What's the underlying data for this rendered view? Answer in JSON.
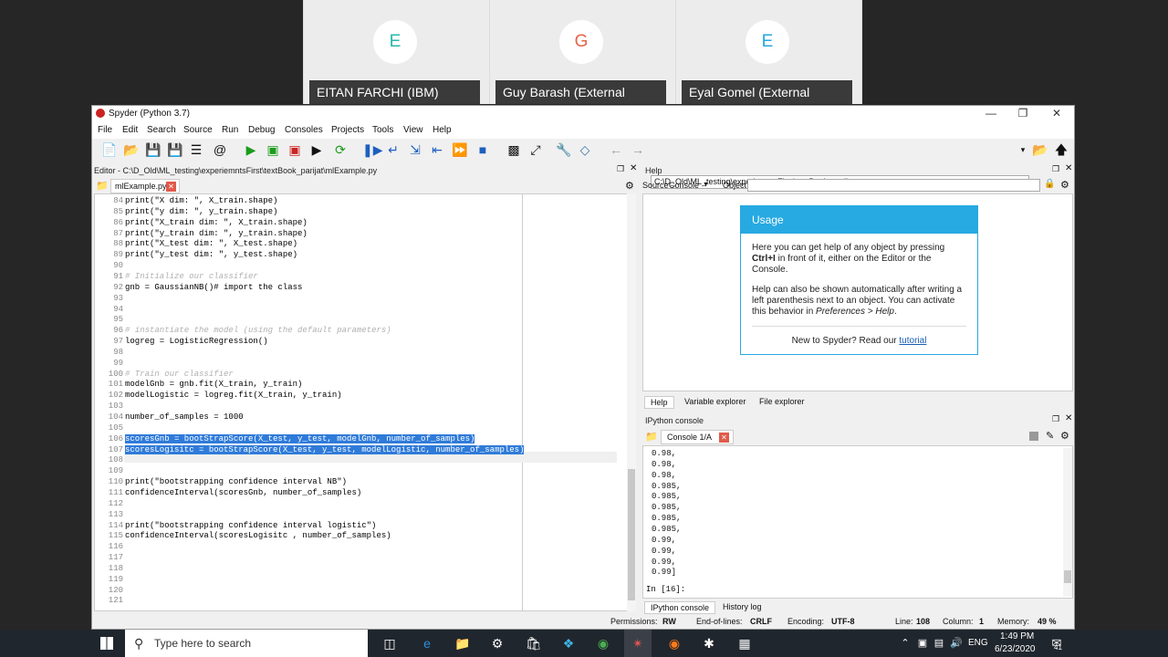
{
  "participants": [
    {
      "initial": "E",
      "name": "EITAN FARCHI (IBM)",
      "color": "#26b8a8"
    },
    {
      "initial": "G",
      "name": "Guy Barash (External",
      "color": "#e8624a"
    },
    {
      "initial": "E",
      "name": "Eyal Gomel (External",
      "color": "#26a7e0"
    }
  ],
  "window": {
    "title": "Spyder (Python 3.7)"
  },
  "menu": [
    "File",
    "Edit",
    "Search",
    "Source",
    "Run",
    "Debug",
    "Consoles",
    "Projects",
    "Tools",
    "View",
    "Help"
  ],
  "toolbar": {
    "path": "C:\\D_Old\\ML_testing\\experiemntsFirst\\textBook_parijat"
  },
  "editor": {
    "title": "Editor - C:\\D_Old\\ML_testing\\experiemntsFirst\\textBook_parijat\\mlExample.py",
    "tab": "mlExample.py",
    "lines": [
      {
        "n": "84",
        "t": "print(\"X dim: \", X_train.shape)",
        "c": "code"
      },
      {
        "n": "85",
        "t": "print(\"y dim: \", y_train.shape)",
        "c": "code"
      },
      {
        "n": "86",
        "t": "print(\"X_train dim: \", X_train.shape)",
        "c": "code"
      },
      {
        "n": "87",
        "t": "print(\"y_train dim: \", y_train.shape)",
        "c": "code"
      },
      {
        "n": "88",
        "t": "print(\"X_test dim: \", X_test.shape)",
        "c": "code"
      },
      {
        "n": "89",
        "t": "print(\"y_test dim: \", y_test.shape)",
        "c": "code"
      },
      {
        "n": "90",
        "t": "",
        "c": "code"
      },
      {
        "n": "91",
        "t": "# Initialize our classifier",
        "c": "cm"
      },
      {
        "n": "92",
        "t": "gnb = GaussianNB()# import the class",
        "c": "code"
      },
      {
        "n": "93",
        "t": "",
        "c": "code"
      },
      {
        "n": "94",
        "t": "",
        "c": "code"
      },
      {
        "n": "95",
        "t": "",
        "c": "code"
      },
      {
        "n": "96",
        "t": "# instantiate the model (using the default parameters)",
        "c": "cm"
      },
      {
        "n": "97",
        "t": "logreg = LogisticRegression()",
        "c": "code"
      },
      {
        "n": "98",
        "t": "",
        "c": "code"
      },
      {
        "n": "99",
        "t": "",
        "c": "code"
      },
      {
        "n": "100",
        "t": "# Train our classifier",
        "c": "cm"
      },
      {
        "n": "101",
        "t": "modelGnb = gnb.fit(X_train, y_train)",
        "c": "code"
      },
      {
        "n": "102",
        "t": "modelLogistic = logreg.fit(X_train, y_train)",
        "c": "code"
      },
      {
        "n": "103",
        "t": "",
        "c": "code"
      },
      {
        "n": "104",
        "t": "number_of_samples = 1000",
        "c": "code"
      },
      {
        "n": "105",
        "t": "",
        "c": "code"
      },
      {
        "n": "106",
        "t": "scoresGnb = bootStrapScore(X_test, y_test, modelGnb, number_of_samples)",
        "c": "sel"
      },
      {
        "n": "107",
        "t": "scoresLogisitc = bootStrapScore(X_test, y_test, modelLogistic, number_of_samples)",
        "c": "sel"
      },
      {
        "n": "108",
        "t": "",
        "c": "code"
      },
      {
        "n": "109",
        "t": "",
        "c": "code"
      },
      {
        "n": "110",
        "t": "print(\"bootstrapping confidence interval NB\")",
        "c": "code"
      },
      {
        "n": "111",
        "t": "confidenceInterval(scoresGnb, number_of_samples)",
        "c": "code"
      },
      {
        "n": "112",
        "t": "",
        "c": "code"
      },
      {
        "n": "113",
        "t": "",
        "c": "code"
      },
      {
        "n": "114",
        "t": "print(\"bootstrapping confidence interval logistic\")",
        "c": "code"
      },
      {
        "n": "115",
        "t": "confidenceInterval(scoresLogisitc , number_of_samples)",
        "c": "code"
      },
      {
        "n": "116",
        "t": "",
        "c": "code"
      },
      {
        "n": "117",
        "t": "",
        "c": "code"
      },
      {
        "n": "118",
        "t": "",
        "c": "code"
      },
      {
        "n": "119",
        "t": "",
        "c": "code"
      },
      {
        "n": "120",
        "t": "",
        "c": "code"
      },
      {
        "n": "121",
        "t": "",
        "c": "code"
      }
    ]
  },
  "help": {
    "title": "Help",
    "source_label": "Source",
    "source_value": "Console",
    "object_label": "Object",
    "usage_title": "Usage",
    "p1a": "Here you can get help of any object by pressing ",
    "p1b": "Ctrl+I",
    "p1c": " in front of it, either on the Editor or the Console.",
    "p2a": "Help can also be shown automatically after writing a left parenthesis next to an object. You can activate this behavior in ",
    "p2b": "Preferences > Help",
    "p3a": "New to Spyder? Read our ",
    "p3b": "tutorial",
    "tabs": [
      "Help",
      "Variable explorer",
      "File explorer"
    ]
  },
  "console": {
    "title": "IPython console",
    "tab": "Console 1/A",
    "lines": [
      "0.98,",
      "0.98,",
      "0.98,",
      "0.985,",
      "0.985,",
      "0.985,",
      "0.985,",
      "0.985,",
      "0.99,",
      "0.99,",
      "0.99,",
      "0.99]"
    ],
    "prompt": "In [16]:",
    "tabs": [
      "IPython console",
      "History log"
    ]
  },
  "status": {
    "perm_label": "Permissions:",
    "perm": "RW",
    "eol_label": "End-of-lines:",
    "eol": "CRLF",
    "enc_label": "Encoding:",
    "enc": "UTF-8",
    "line_label": "Line:",
    "line": "108",
    "col_label": "Column:",
    "col": "1",
    "mem_label": "Memory:",
    "mem": "49 %"
  },
  "taskbar": {
    "search": "Type here to search",
    "lang": "ENG",
    "time": "1:49 PM",
    "date": "6/23/2020",
    "notif": "41"
  }
}
